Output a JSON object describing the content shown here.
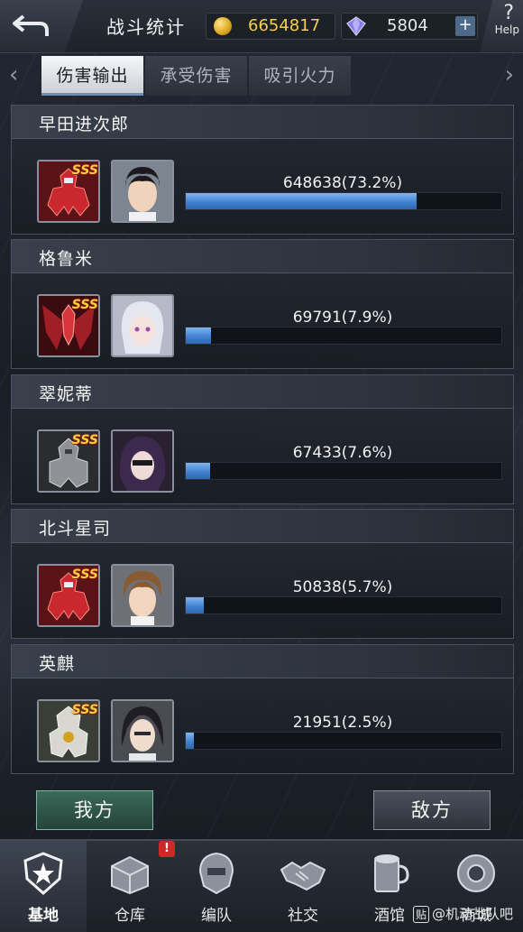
{
  "header": {
    "title": "战斗统计",
    "gold": "6654817",
    "gems": "5804",
    "plus_label": "+",
    "help_label": "Help"
  },
  "tabs": [
    {
      "label": "伤害输出",
      "active": true
    },
    {
      "label": "承受伤害",
      "active": false
    },
    {
      "label": "吸引火力",
      "active": false
    }
  ],
  "rankings": [
    {
      "name": "早田进次郎",
      "badge": "SSS",
      "damage_text": "648638(73.2%)",
      "percent": 73.2
    },
    {
      "name": "格鲁米",
      "badge": "SSS",
      "damage_text": "69791(7.9%)",
      "percent": 7.9
    },
    {
      "name": "翠妮蒂",
      "badge": "SSS",
      "damage_text": "67433(7.6%)",
      "percent": 7.6
    },
    {
      "name": "北斗星司",
      "badge": "SSS",
      "damage_text": "50838(5.7%)",
      "percent": 5.7
    },
    {
      "name": "英麒",
      "badge": "SSS",
      "damage_text": "21951(2.5%)",
      "percent": 2.5
    }
  ],
  "team_buttons": {
    "ours": "我方",
    "enemy": "敌方"
  },
  "nav": [
    {
      "label": "基地",
      "icon": "base-icon",
      "active": true
    },
    {
      "label": "仓库",
      "icon": "warehouse-icon",
      "active": false
    },
    {
      "label": "编队",
      "icon": "formation-icon",
      "active": false
    },
    {
      "label": "社交",
      "icon": "social-icon",
      "active": false
    },
    {
      "label": "酒馆",
      "icon": "tavern-icon",
      "active": false
    },
    {
      "label": "商城",
      "icon": "shop-icon",
      "active": false
    }
  ],
  "warehouse_notice": "!",
  "watermark": {
    "box": "贴",
    "text": "@机动战队吧"
  },
  "colors": {
    "bar_fill": "#3d7fcf",
    "gold_text": "#f5cf4c",
    "badge": "#ffd040",
    "ours_button": "#3c6a5a"
  }
}
